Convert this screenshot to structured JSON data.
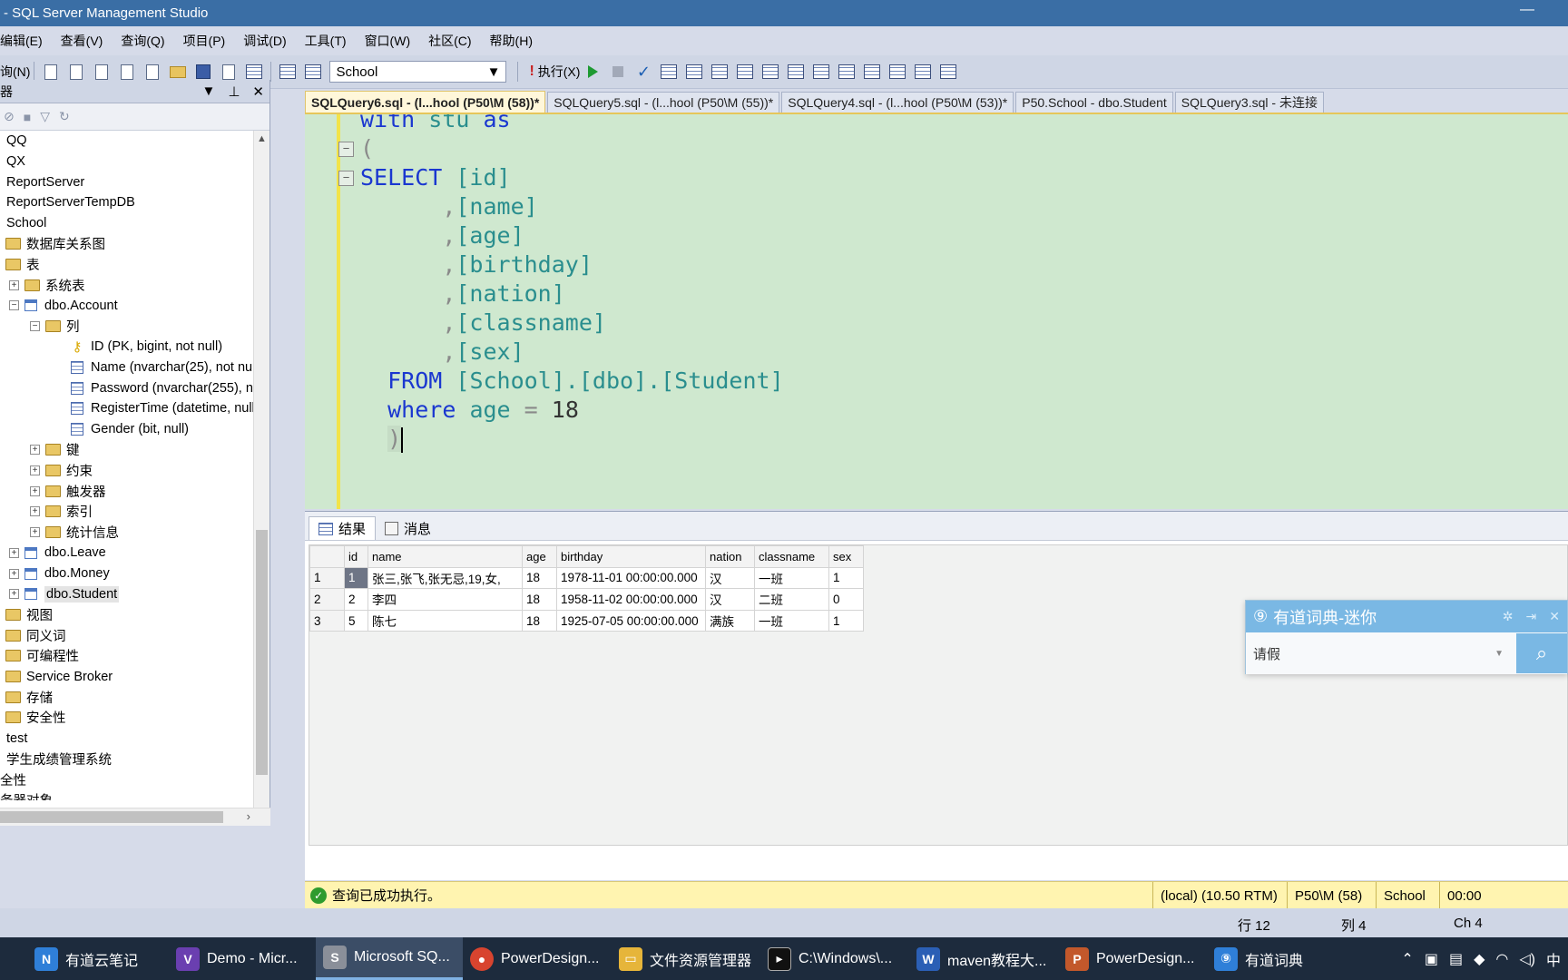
{
  "window": {
    "title": "- SQL Server Management Studio",
    "minimize": "—"
  },
  "menu": [
    "编辑(E)",
    "查看(V)",
    "查询(Q)",
    "项目(P)",
    "调试(D)",
    "工具(T)",
    "窗口(W)",
    "社区(C)",
    "帮助(H)"
  ],
  "toolbar": {
    "new_query_label": "询(N)",
    "database": "School",
    "execute_label": "执行(X)"
  },
  "object_explorer": {
    "title": "器",
    "nodes": [
      {
        "label": "QQ"
      },
      {
        "label": "QX"
      },
      {
        "label": "ReportServer"
      },
      {
        "label": "ReportServerTempDB"
      },
      {
        "label": "School"
      },
      {
        "label": "数据库关系图"
      },
      {
        "label": "表"
      },
      {
        "label": "系统表"
      },
      {
        "label": "dbo.Account"
      },
      {
        "label": "列"
      },
      {
        "label": "ID (PK, bigint, not null)"
      },
      {
        "label": "Name (nvarchar(25), not nul"
      },
      {
        "label": "Password (nvarchar(255), nc"
      },
      {
        "label": "RegisterTime (datetime, null"
      },
      {
        "label": "Gender (bit, null)"
      },
      {
        "label": "键"
      },
      {
        "label": "约束"
      },
      {
        "label": "触发器"
      },
      {
        "label": "索引"
      },
      {
        "label": "统计信息"
      },
      {
        "label": "dbo.Leave"
      },
      {
        "label": "dbo.Money"
      },
      {
        "label": "dbo.Student"
      },
      {
        "label": "视图"
      },
      {
        "label": "同义词"
      },
      {
        "label": "可编程性"
      },
      {
        "label": "Service Broker"
      },
      {
        "label": "存储"
      },
      {
        "label": "安全性"
      },
      {
        "label": "test"
      },
      {
        "label": "学生成绩管理系统"
      },
      {
        "label": "全性"
      },
      {
        "label": "务器对象"
      }
    ]
  },
  "tabs": [
    {
      "label": "SQLQuery6.sql - (l...hool (P50\\M (58))*",
      "active": true
    },
    {
      "label": "SQLQuery5.sql - (l...hool (P50\\M (55))*"
    },
    {
      "label": "SQLQuery4.sql - (l...hool (P50\\M (53))*"
    },
    {
      "label": "P50.School - dbo.Student"
    },
    {
      "label": "SQLQuery3.sql - 未连接"
    }
  ],
  "code": {
    "l1_kw": "with",
    "l1_name": "stu",
    "l1_kw2": "as",
    "l2": "(",
    "l3_kw": "SELECT",
    "l3_col": "[id]",
    "c_name": "[name]",
    "c_age": "[age]",
    "c_birthday": "[birthday]",
    "c_nation": "[nation]",
    "c_classname": "[classname]",
    "c_sex": "[sex]",
    "comma": ",",
    "from_kw": "FROM",
    "from_obj": "[School].[dbo].[Student]",
    "where_kw": "where",
    "where_col": "age",
    "where_op": "=",
    "where_val": "18",
    "close": ")"
  },
  "results": {
    "tab_results": "结果",
    "tab_messages": "消息",
    "columns": [
      "id",
      "name",
      "age",
      "birthday",
      "nation",
      "classname",
      "sex"
    ],
    "rows": [
      {
        "rn": "1",
        "id": "1",
        "name": "张三,张飞,张无忌,19,女,",
        "age": "18",
        "birthday": "1978-11-01 00:00:00.000",
        "nation": "汉",
        "classname": "一班",
        "sex": "1"
      },
      {
        "rn": "2",
        "id": "2",
        "name": "李四",
        "age": "18",
        "birthday": "1958-11-02 00:00:00.000",
        "nation": "汉",
        "classname": "二班",
        "sex": "0"
      },
      {
        "rn": "3",
        "id": "5",
        "name": "陈七",
        "age": "18",
        "birthday": "1925-07-05 00:00:00.000",
        "nation": "满族",
        "classname": "一班",
        "sex": "1"
      }
    ]
  },
  "query_status": {
    "message": "查询已成功执行。",
    "server": "(local) (10.50 RTM)",
    "user": "P50\\M (58)",
    "db": "School",
    "time": "00:00"
  },
  "statusbar": {
    "line": "行 12",
    "col": "列 4",
    "ch": "Ch 4"
  },
  "youdao": {
    "title": "有道词典-迷你",
    "word": "请假"
  },
  "taskbar": [
    {
      "label": "有道云笔记",
      "color": "#2f7fd8"
    },
    {
      "label": "Demo - Micr...",
      "color": "#6a3fb0"
    },
    {
      "label": "Microsoft SQ...",
      "color": "#8a8f99",
      "active": true
    },
    {
      "label": "PowerDesign...",
      "color": "#d8442f"
    },
    {
      "label": "文件资源管理器",
      "color": "#e6b53a"
    },
    {
      "label": "C:\\Windows\\...",
      "color": "#111111"
    },
    {
      "label": "maven教程大...",
      "color": "#2b5fb5"
    },
    {
      "label": "PowerDesign...",
      "color": "#c2582b"
    },
    {
      "label": "有道词典",
      "color": "#2f7fd8"
    }
  ],
  "tray": {
    "ime": "中"
  }
}
